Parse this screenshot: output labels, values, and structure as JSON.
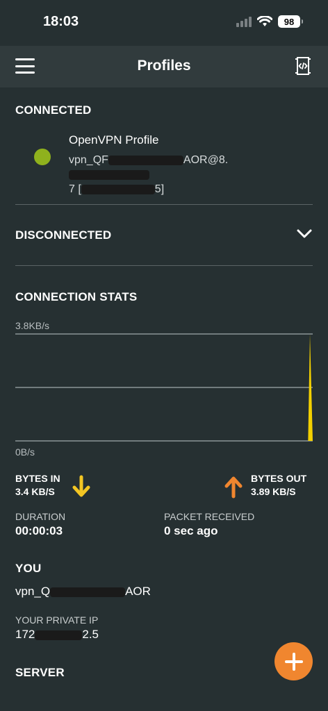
{
  "status": {
    "time": "18:03",
    "battery": "98",
    "icons": [
      "signal-icon",
      "wifi-icon",
      "battery-icon"
    ]
  },
  "header": {
    "title": "Profiles",
    "left_icon": "menu-icon",
    "right_icon": "import-profile-icon"
  },
  "connected": {
    "title": "CONNECTED",
    "profile": {
      "name": "OpenVPN Profile",
      "subtitle_line1": "vpn_QF",
      "subtitle_line2": "7 [",
      "subtitle_tail1": "AOR@8.",
      "subtitle_tail2": "5]"
    }
  },
  "disconnected": {
    "title": "DISCONNECTED",
    "toggle_icon": "chevron-down-icon"
  },
  "stats": {
    "title": "CONNECTION STATS",
    "max_label": "3.8KB/s",
    "min_label": "0B/s",
    "bytes_in_label": "BYTES IN",
    "bytes_in_value": "3.4 KB/S",
    "bytes_out_label": "BYTES OUT",
    "bytes_out_value": "3.89 KB/S",
    "duration_label": "DURATION",
    "duration_value": "00:00:03",
    "packet_label": "PACKET RECEIVED",
    "packet_value": "0 sec ago"
  },
  "you": {
    "title": "YOU",
    "user": "vpn_Q",
    "user_tail": "AOR",
    "private_ip_label": "YOUR PRIVATE IP",
    "private_ip": "172",
    "private_ip_tail": "2.5"
  },
  "server": {
    "title": "SERVER"
  },
  "fab": {
    "icon": "plus-icon"
  },
  "colors": {
    "background": "#263032",
    "header": "#313b3d",
    "connected_dot": "#8fb11d",
    "in_arrow": "#f3c623",
    "out_arrow": "#f0862f",
    "fab": "#f0862f"
  },
  "chart_data": {
    "type": "area",
    "x": [
      0,
      1,
      2,
      3,
      4,
      5,
      6,
      7,
      8,
      9
    ],
    "series": [
      {
        "values": [
          0,
          0,
          0,
          0,
          0,
          0,
          0,
          0,
          0,
          3.8
        ]
      }
    ],
    "ylabel": "",
    "ylim": [
      0,
      3.8
    ],
    "grid": true,
    "colors": [
      "#f3d000"
    ]
  }
}
